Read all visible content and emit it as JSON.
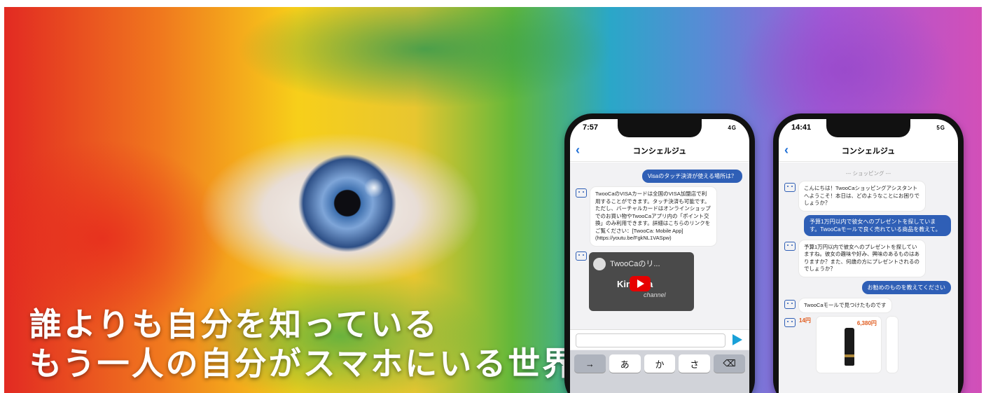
{
  "hero": {
    "tagline_line1": "誰よりも自分を知っている",
    "tagline_line2": "もう一人の自分がスマホにいる世界"
  },
  "colors": {
    "accent_blue": "#2f5fb6",
    "send_blue": "#19a0d8",
    "price_orange": "#e05a1c"
  },
  "phone1": {
    "time": "7:57",
    "signal": "4G",
    "title": "コンシェルジュ",
    "user_message": "Visaのタッチ決済が使える場所は？",
    "bot_message": "TwooCaのVISAカードは全国のVISA加盟店で利用することができます。タッチ決済も可能です。ただし、バーチャルカードはオンラインショップでのお買い物やTwooCaアプリ内の「ポイント交換」のみ利用できます。詳細はこちらのリンクをご覧ください：[TwooCa: Mobile App](https://youtu.be/FgkNL1VASpw)",
    "video_title": "TwooCaのリ...",
    "video_channel": "Kinaluta",
    "video_channel_sub": "channel",
    "keys": [
      "→",
      "あ",
      "か",
      "さ",
      "⌫"
    ]
  },
  "phone2": {
    "time": "14:41",
    "signal": "5G",
    "title": "コンシェルジュ",
    "section": "--- ショッピング ---",
    "bot_greeting": "こんにちは！TwooCaショッピングアシスタントへようこそ！本日は、どのようなことにお困りでしょうか？",
    "user_request": "予算1万円以内で彼女へのプレゼントを探しています。TwooCaモールで良く売れている商品を教えて。",
    "bot_followup": "予算1万円以内で彼女へのプレゼントを探していますね。彼女の趣味や好み、興味のあるものはありますか？また、何歳の方にプレゼントされるのでしょうか？",
    "user_recommend": "お勧めのものを教えてください",
    "bot_found": "TwooCaモールで見つけたものです",
    "price_small": "14円",
    "price_product": "6,380円"
  }
}
